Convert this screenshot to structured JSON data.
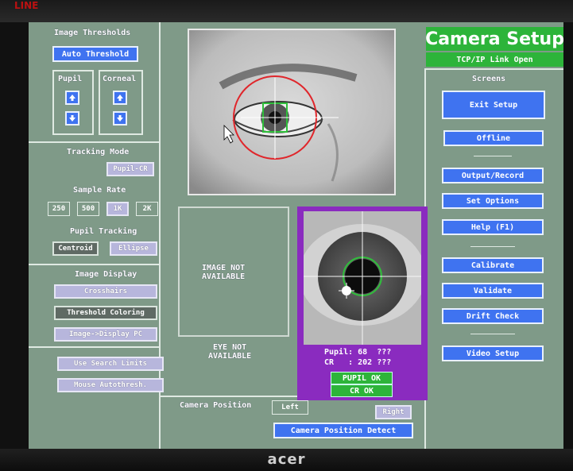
{
  "monitor": {
    "badge": "LINE",
    "brand": "acer"
  },
  "header": {
    "title": "Camera Setup",
    "subtitle": "TCP/IP Link Open"
  },
  "thresholds": {
    "heading": "Image Thresholds",
    "auto_label": "Auto Threshold",
    "pupil_label": "Pupil",
    "corneal_label": "Corneal"
  },
  "tracking_mode": {
    "heading": "Tracking Mode",
    "value": "Pupil-CR"
  },
  "sample_rate": {
    "heading": "Sample Rate",
    "options": [
      "250",
      "500",
      "1K",
      "2K"
    ],
    "selected": "1K"
  },
  "pupil_tracking": {
    "heading": "Pupil Tracking",
    "options": [
      "Centroid",
      "Ellipse"
    ],
    "selected": "Centroid"
  },
  "image_display": {
    "heading": "Image Display",
    "crosshairs": "Crosshairs",
    "threshold_coloring": "Threshold Coloring",
    "image_to_display": "Image->Display PC"
  },
  "search": {
    "use_limits": "Use Search Limits",
    "mouse_autothresh": "Mouse Autothresh."
  },
  "images": {
    "image_not_available": "IMAGE NOT\nAVAILABLE",
    "eye_not_available": "EYE NOT\nAVAILABLE"
  },
  "eye_status": {
    "pupil_line": "Pupil: 68  ???",
    "cr_line": "CR   : 202 ???",
    "pupil_ok": "PUPIL OK",
    "cr_ok": "CR  OK"
  },
  "camera_position": {
    "label": "Camera Position",
    "left": "Left",
    "right": "Right",
    "detect": "Camera Position Detect"
  },
  "screens": {
    "heading": "Screens",
    "exit": "Exit Setup",
    "offline": "Offline",
    "output": "Output/Record",
    "options": "Set Options",
    "help": "Help (F1)",
    "calibrate": "Calibrate",
    "validate": "Validate",
    "drift": "Drift Check",
    "video": "Video Setup"
  },
  "colors": {
    "background": "#7f9a88",
    "button": "#3f73f0",
    "status_green": "#2db43a",
    "eye_panel": "#8a2bbf"
  }
}
